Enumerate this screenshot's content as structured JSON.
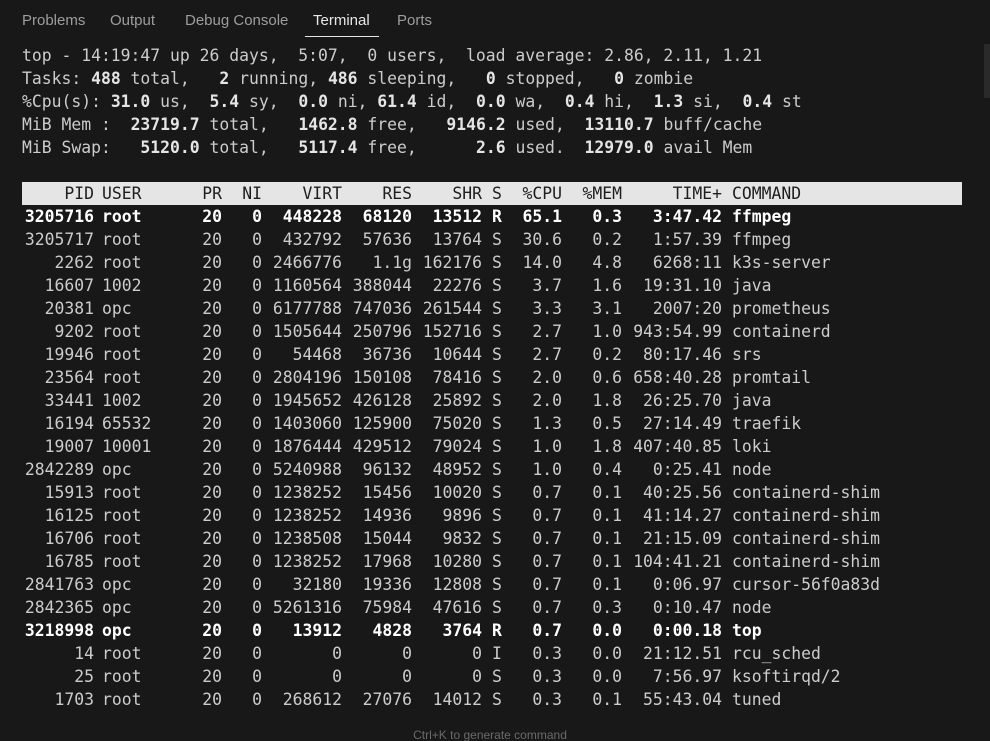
{
  "panel": {
    "tabs": [
      {
        "label": "Problems"
      },
      {
        "label": "Output"
      },
      {
        "label": "Debug Console"
      },
      {
        "label": "Terminal"
      },
      {
        "label": "Ports"
      }
    ],
    "active_tab": "Terminal"
  },
  "summary": {
    "line1": "top - 14:19:47 up 26 days,  5:07,  0 users,  load average: 2.86, 2.11, 1.21",
    "tasks": {
      "total": "488",
      "running": "2",
      "sleeping": "486",
      "stopped": "0",
      "zombie": "0"
    },
    "cpu": {
      "us": "31.0",
      "sy": "5.4",
      "ni": "0.0",
      "id": "61.4",
      "wa": "0.0",
      "hi": "0.4",
      "si": "1.3",
      "st": "0.4"
    },
    "mem": {
      "total": "23719.7",
      "free": "1462.8",
      "used": "9146.2",
      "buff_cache": "13110.7"
    },
    "swap": {
      "total": "5120.0",
      "free": "5117.4",
      "used": "2.6",
      "avail_mem": "12979.0"
    }
  },
  "table": {
    "headers": [
      "PID",
      "USER",
      "PR",
      "NI",
      "VIRT",
      "RES",
      "SHR",
      "S",
      "%CPU",
      "%MEM",
      "TIME+",
      "COMMAND"
    ],
    "rows": [
      {
        "pid": "3205716",
        "user": "root",
        "pr": "20",
        "ni": "0",
        "virt": "448228",
        "res": "68120",
        "shr": "13512",
        "s": "R",
        "cpu": "65.1",
        "mem": "0.3",
        "time": "3:47.42",
        "cmd": "ffmpeg",
        "bold": true
      },
      {
        "pid": "3205717",
        "user": "root",
        "pr": "20",
        "ni": "0",
        "virt": "432792",
        "res": "57636",
        "shr": "13764",
        "s": "S",
        "cpu": "30.6",
        "mem": "0.2",
        "time": "1:57.39",
        "cmd": "ffmpeg"
      },
      {
        "pid": "2262",
        "user": "root",
        "pr": "20",
        "ni": "0",
        "virt": "2466776",
        "res": "1.1g",
        "shr": "162176",
        "s": "S",
        "cpu": "14.0",
        "mem": "4.8",
        "time": "6268:11",
        "cmd": "k3s-server"
      },
      {
        "pid": "16607",
        "user": "1002",
        "pr": "20",
        "ni": "0",
        "virt": "1160564",
        "res": "388044",
        "shr": "22276",
        "s": "S",
        "cpu": "3.7",
        "mem": "1.6",
        "time": "19:31.10",
        "cmd": "java"
      },
      {
        "pid": "20381",
        "user": "opc",
        "pr": "20",
        "ni": "0",
        "virt": "6177788",
        "res": "747036",
        "shr": "261544",
        "s": "S",
        "cpu": "3.3",
        "mem": "3.1",
        "time": "2007:20",
        "cmd": "prometheus"
      },
      {
        "pid": "9202",
        "user": "root",
        "pr": "20",
        "ni": "0",
        "virt": "1505644",
        "res": "250796",
        "shr": "152716",
        "s": "S",
        "cpu": "2.7",
        "mem": "1.0",
        "time": "943:54.99",
        "cmd": "containerd"
      },
      {
        "pid": "19946",
        "user": "root",
        "pr": "20",
        "ni": "0",
        "virt": "54468",
        "res": "36736",
        "shr": "10644",
        "s": "S",
        "cpu": "2.7",
        "mem": "0.2",
        "time": "80:17.46",
        "cmd": "srs"
      },
      {
        "pid": "23564",
        "user": "root",
        "pr": "20",
        "ni": "0",
        "virt": "2804196",
        "res": "150108",
        "shr": "78416",
        "s": "S",
        "cpu": "2.0",
        "mem": "0.6",
        "time": "658:40.28",
        "cmd": "promtail"
      },
      {
        "pid": "33441",
        "user": "1002",
        "pr": "20",
        "ni": "0",
        "virt": "1945652",
        "res": "426128",
        "shr": "25892",
        "s": "S",
        "cpu": "2.0",
        "mem": "1.8",
        "time": "26:25.70",
        "cmd": "java"
      },
      {
        "pid": "16194",
        "user": "65532",
        "pr": "20",
        "ni": "0",
        "virt": "1403060",
        "res": "125900",
        "shr": "75020",
        "s": "S",
        "cpu": "1.3",
        "mem": "0.5",
        "time": "27:14.49",
        "cmd": "traefik"
      },
      {
        "pid": "19007",
        "user": "10001",
        "pr": "20",
        "ni": "0",
        "virt": "1876444",
        "res": "429512",
        "shr": "79024",
        "s": "S",
        "cpu": "1.0",
        "mem": "1.8",
        "time": "407:40.85",
        "cmd": "loki"
      },
      {
        "pid": "2842289",
        "user": "opc",
        "pr": "20",
        "ni": "0",
        "virt": "5240988",
        "res": "96132",
        "shr": "48952",
        "s": "S",
        "cpu": "1.0",
        "mem": "0.4",
        "time": "0:25.41",
        "cmd": "node"
      },
      {
        "pid": "15913",
        "user": "root",
        "pr": "20",
        "ni": "0",
        "virt": "1238252",
        "res": "15456",
        "shr": "10020",
        "s": "S",
        "cpu": "0.7",
        "mem": "0.1",
        "time": "40:25.56",
        "cmd": "containerd-shim"
      },
      {
        "pid": "16125",
        "user": "root",
        "pr": "20",
        "ni": "0",
        "virt": "1238252",
        "res": "14936",
        "shr": "9896",
        "s": "S",
        "cpu": "0.7",
        "mem": "0.1",
        "time": "41:14.27",
        "cmd": "containerd-shim"
      },
      {
        "pid": "16706",
        "user": "root",
        "pr": "20",
        "ni": "0",
        "virt": "1238508",
        "res": "15044",
        "shr": "9832",
        "s": "S",
        "cpu": "0.7",
        "mem": "0.1",
        "time": "21:15.09",
        "cmd": "containerd-shim"
      },
      {
        "pid": "16785",
        "user": "root",
        "pr": "20",
        "ni": "0",
        "virt": "1238252",
        "res": "17968",
        "shr": "10280",
        "s": "S",
        "cpu": "0.7",
        "mem": "0.1",
        "time": "104:41.21",
        "cmd": "containerd-shim"
      },
      {
        "pid": "2841763",
        "user": "opc",
        "pr": "20",
        "ni": "0",
        "virt": "32180",
        "res": "19336",
        "shr": "12808",
        "s": "S",
        "cpu": "0.7",
        "mem": "0.1",
        "time": "0:06.97",
        "cmd": "cursor-56f0a83d"
      },
      {
        "pid": "2842365",
        "user": "opc",
        "pr": "20",
        "ni": "0",
        "virt": "5261316",
        "res": "75984",
        "shr": "47616",
        "s": "S",
        "cpu": "0.7",
        "mem": "0.3",
        "time": "0:10.47",
        "cmd": "node"
      },
      {
        "pid": "3218998",
        "user": "opc",
        "pr": "20",
        "ni": "0",
        "virt": "13912",
        "res": "4828",
        "shr": "3764",
        "s": "R",
        "cpu": "0.7",
        "mem": "0.0",
        "time": "0:00.18",
        "cmd": "top",
        "bold": true
      },
      {
        "pid": "14",
        "user": "root",
        "pr": "20",
        "ni": "0",
        "virt": "0",
        "res": "0",
        "shr": "0",
        "s": "I",
        "cpu": "0.3",
        "mem": "0.0",
        "time": "21:12.51",
        "cmd": "rcu_sched"
      },
      {
        "pid": "25",
        "user": "root",
        "pr": "20",
        "ni": "0",
        "virt": "0",
        "res": "0",
        "shr": "0",
        "s": "S",
        "cpu": "0.3",
        "mem": "0.0",
        "time": "7:56.97",
        "cmd": "ksoftirqd/2"
      },
      {
        "pid": "1703",
        "user": "root",
        "pr": "20",
        "ni": "0",
        "virt": "268612",
        "res": "27076",
        "shr": "14012",
        "s": "S",
        "cpu": "0.3",
        "mem": "0.1",
        "time": "55:43.04",
        "cmd": "tuned"
      }
    ]
  },
  "hint": "Ctrl+K to generate command"
}
